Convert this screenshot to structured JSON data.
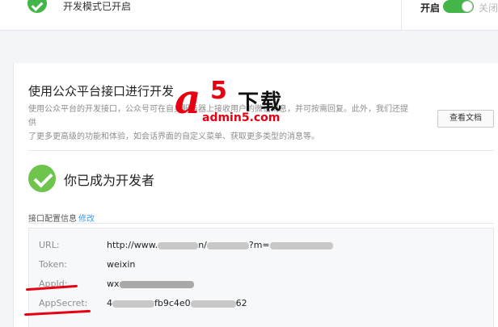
{
  "header": {
    "title": "开发模式已开启",
    "toggle_on_label": "开启",
    "toggle_off_label": "关闭"
  },
  "developer": {
    "title": "使用公众平台接口进行开发",
    "description_line1": "使用公众平台的开发接口，公众号可在自身服务器上接收用户的微信消息，并可按需回复。此外，我们还提供",
    "description_line2": "了更多更高级的功能和体验，如会话界面的自定义菜单、获取更多类型的消息等。",
    "docs_button": "查看文档"
  },
  "watermark": {
    "logo_a": "a",
    "logo_5": "5",
    "logo_cn": "下载",
    "url": "admin5.com"
  },
  "status": {
    "became_developer": "你已成为开发者"
  },
  "config": {
    "section_label": "接口配置信息",
    "edit_label": "修改",
    "rows": [
      {
        "key": "URL:",
        "value_a": "http://www.",
        "value_b": "n/",
        "value_c": "?m="
      },
      {
        "key": "Token:",
        "value_a": "weixin"
      },
      {
        "key": "AppId:",
        "value_a": "wx"
      },
      {
        "key": "AppSecret:",
        "value_a": "4",
        "value_b": "fb9c4e0",
        "value_c": "62"
      }
    ]
  },
  "colors": {
    "accent_green": "#44b549",
    "link_blue": "#459ae9",
    "annotation_red": "#e60012"
  }
}
